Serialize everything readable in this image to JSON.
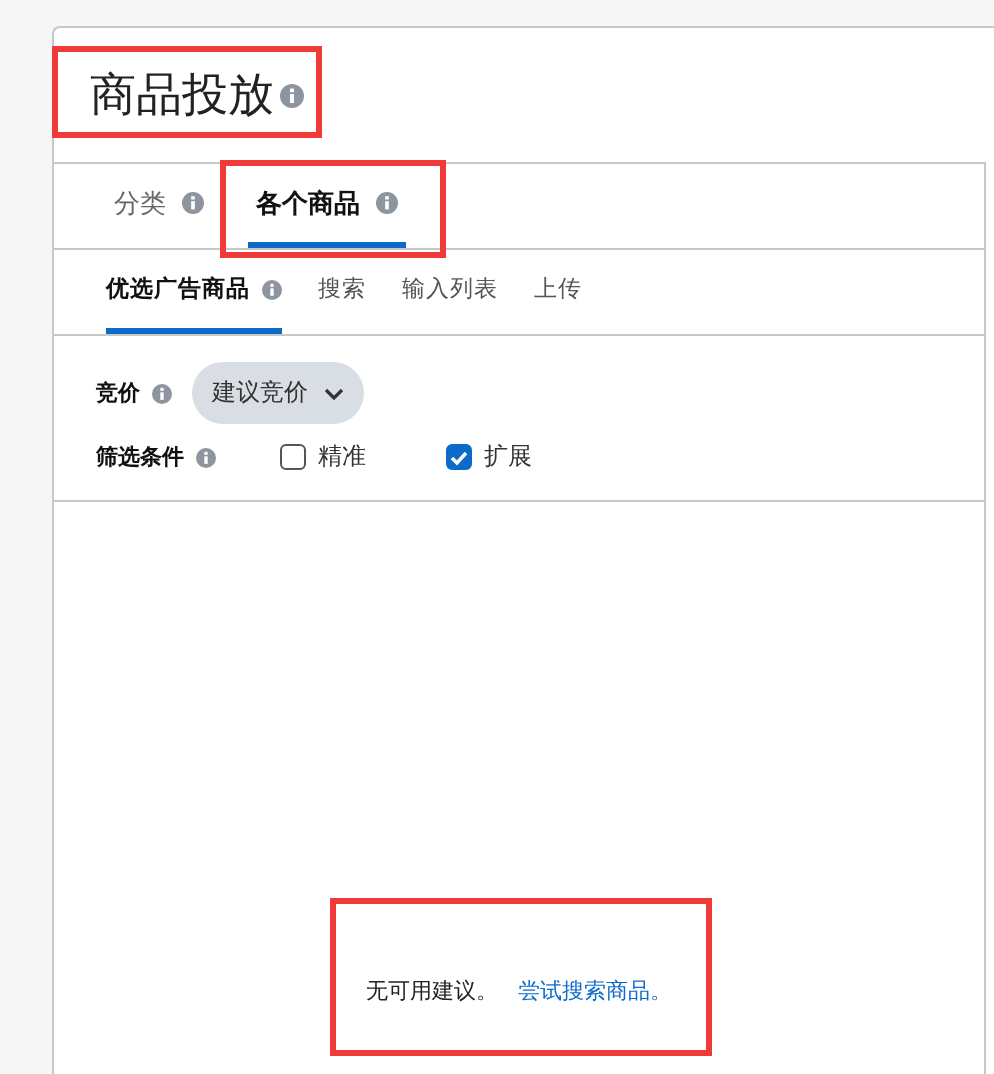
{
  "title": {
    "text": "商品投放",
    "highlighted": true
  },
  "tabs": [
    {
      "label": "分类",
      "selected": false,
      "highlighted": false
    },
    {
      "label": "各个商品",
      "selected": true,
      "highlighted": true
    }
  ],
  "subtabs": [
    {
      "label": "优选广告商品",
      "selected": true,
      "info": true
    },
    {
      "label": "搜索",
      "selected": false,
      "info": false
    },
    {
      "label": "输入列表",
      "selected": false,
      "info": false
    },
    {
      "label": "上传",
      "selected": false,
      "info": false
    }
  ],
  "bid": {
    "label": "竞价",
    "value": "建议竞价"
  },
  "filter": {
    "label": "筛选条件",
    "options": [
      {
        "label": "精准",
        "checked": false
      },
      {
        "label": "扩展",
        "checked": true
      }
    ]
  },
  "empty": {
    "message": "无可用建议。",
    "link": "尝试搜索商品。",
    "highlighted": true
  }
}
